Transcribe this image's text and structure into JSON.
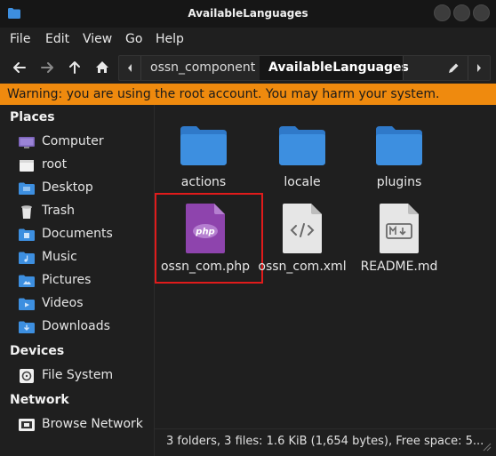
{
  "window": {
    "title": "AvailableLanguages"
  },
  "menu": [
    "File",
    "Edit",
    "View",
    "Go",
    "Help"
  ],
  "toolbar": {
    "back_icon": "back-arrow-icon",
    "forward_icon": "forward-arrow-icon",
    "up_icon": "up-arrow-icon",
    "home_icon": "home-icon",
    "breadcrumbs": [
      "ossn_component",
      "AvailableLanguages"
    ],
    "edit_icon": "pencil-icon"
  },
  "warning": "Warning: you are using the root account. You may harm your system.",
  "sidebar": {
    "places_heading": "Places",
    "places": [
      {
        "label": "Computer",
        "icon": "computer-icon"
      },
      {
        "label": "root",
        "icon": "home-folder-icon"
      },
      {
        "label": "Desktop",
        "icon": "desktop-folder-icon"
      },
      {
        "label": "Trash",
        "icon": "trash-icon"
      },
      {
        "label": "Documents",
        "icon": "documents-folder-icon"
      },
      {
        "label": "Music",
        "icon": "music-folder-icon"
      },
      {
        "label": "Pictures",
        "icon": "pictures-folder-icon"
      },
      {
        "label": "Videos",
        "icon": "videos-folder-icon"
      },
      {
        "label": "Downloads",
        "icon": "downloads-folder-icon"
      }
    ],
    "devices_heading": "Devices",
    "devices": [
      {
        "label": "File System",
        "icon": "drive-icon"
      }
    ],
    "network_heading": "Network",
    "network": [
      {
        "label": "Browse Network",
        "icon": "network-icon"
      }
    ]
  },
  "files": [
    {
      "name": "actions",
      "type": "folder"
    },
    {
      "name": "locale",
      "type": "folder"
    },
    {
      "name": "plugins",
      "type": "folder"
    },
    {
      "name": "ossn_com.php",
      "type": "php",
      "selected": true
    },
    {
      "name": "ossn_com.xml",
      "type": "xml"
    },
    {
      "name": "README.md",
      "type": "markdown"
    }
  ],
  "status": "3 folders, 3 files: 1.6 KiB (1,654 bytes), Free space: 5...",
  "colors": {
    "warning_bg": "#ef8a0e",
    "folder_blue": "#3d8fe0",
    "php_purple": "#8e44ad",
    "selection_red": "#e01b1b"
  }
}
